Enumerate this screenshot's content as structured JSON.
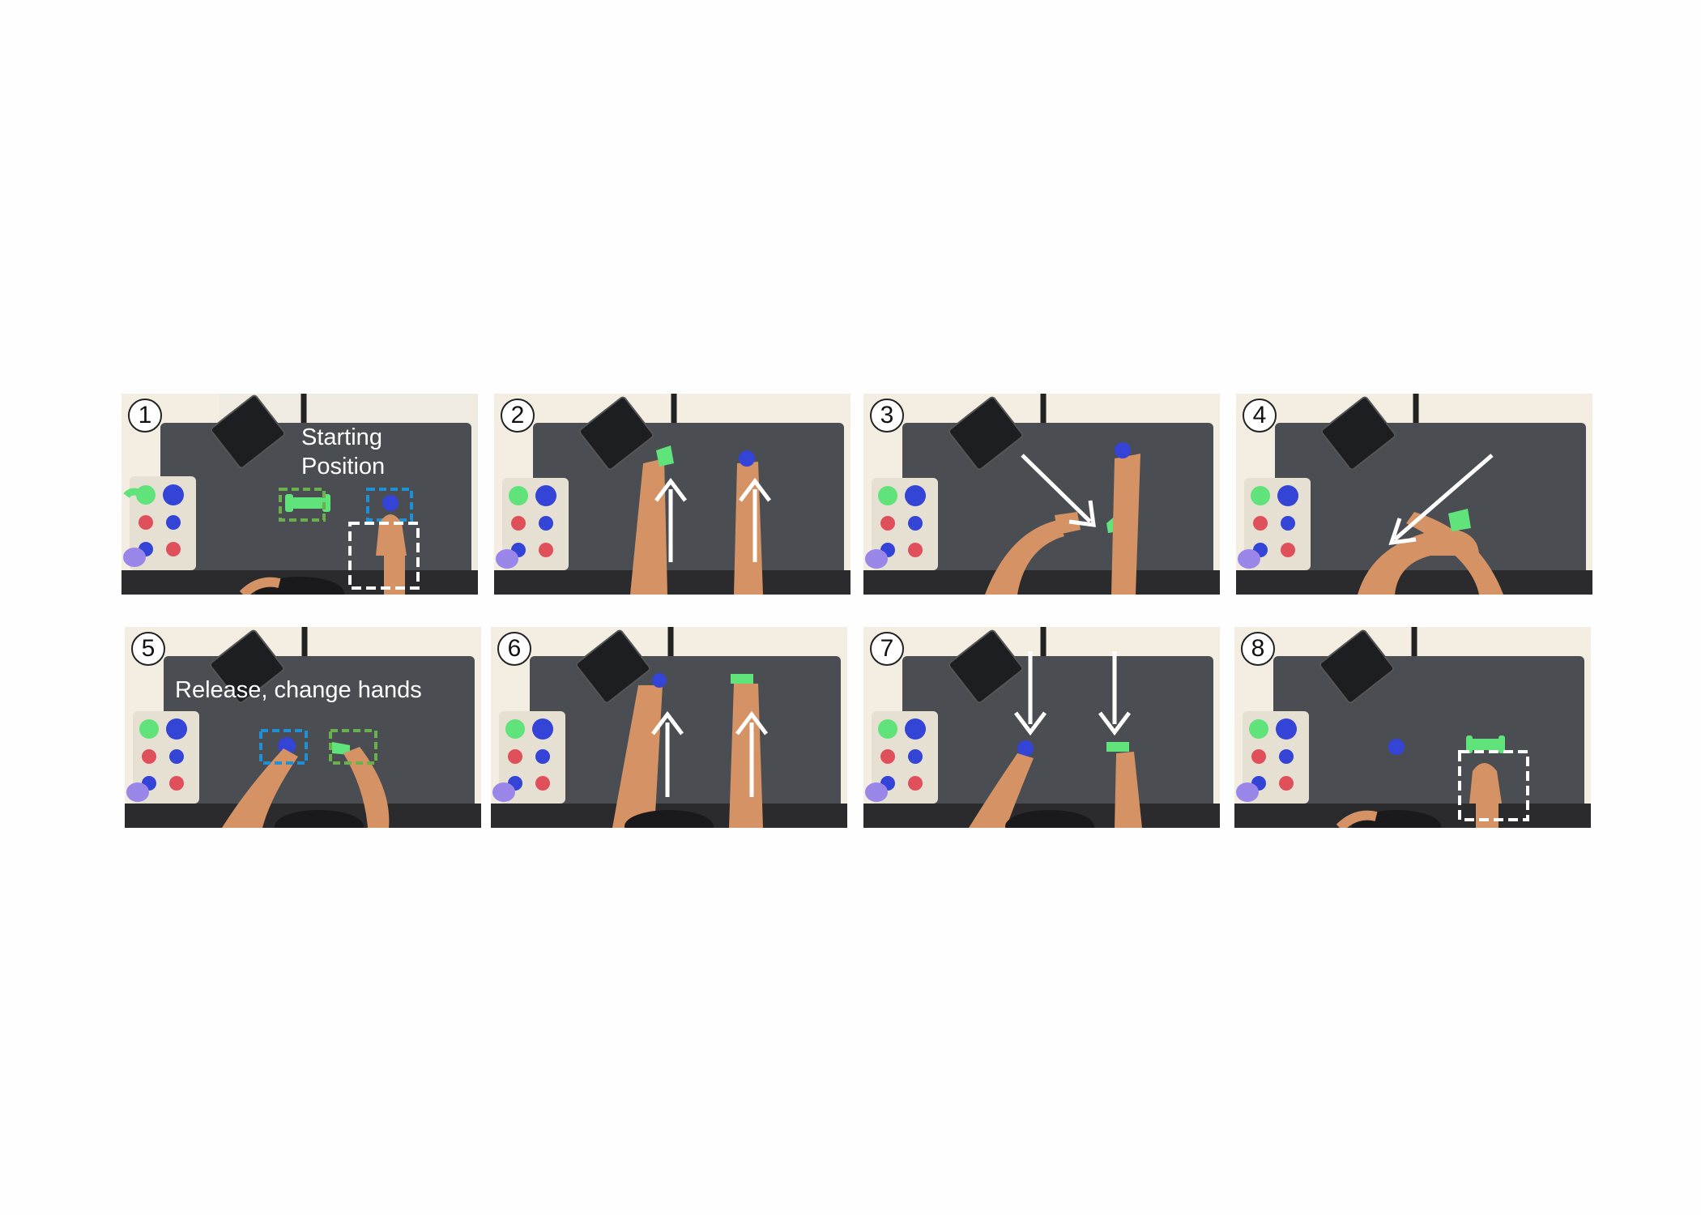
{
  "figure": {
    "panels": [
      {
        "step": "1",
        "caption_lines": [
          "Starting",
          "Position"
        ]
      },
      {
        "step": "2"
      },
      {
        "step": "3"
      },
      {
        "step": "4"
      },
      {
        "step": "5",
        "caption_lines": [
          "Release, change hands"
        ]
      },
      {
        "step": "6"
      },
      {
        "step": "7"
      },
      {
        "step": "8"
      }
    ]
  },
  "colors": {
    "table_surface": "#f3ede2",
    "mat": "#4a4d52",
    "floor_carpet": "#2b2b2e",
    "skin": "#d49265",
    "green_object": "#5fe37a",
    "blue_object": "#3344d6",
    "red_object": "#e0505a",
    "purple_object": "#9a86e8",
    "tablet": "#1d1e21",
    "organizer_tray": "#e6e0d2",
    "box_green": "#6ab04c",
    "box_blue": "#1f8fd6",
    "box_white": "#ffffff",
    "arrow": "#ffffff"
  }
}
